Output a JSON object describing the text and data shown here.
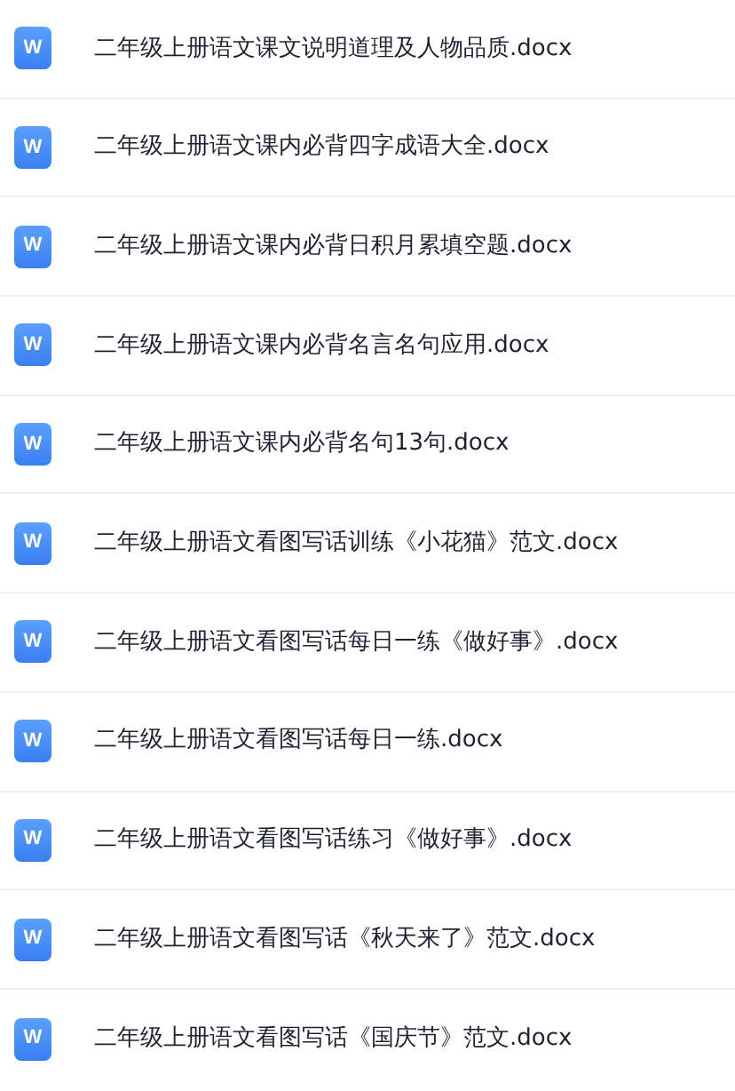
{
  "files": [
    {
      "icon_letter": "W",
      "name": "二年级上册语文课文说明道理及人物品质.docx"
    },
    {
      "icon_letter": "W",
      "name": "二年级上册语文课内必背四字成语大全.docx"
    },
    {
      "icon_letter": "W",
      "name": "二年级上册语文课内必背日积月累填空题.docx"
    },
    {
      "icon_letter": "W",
      "name": "二年级上册语文课内必背名言名句应用.docx"
    },
    {
      "icon_letter": "W",
      "name": "二年级上册语文课内必背名句13句.docx"
    },
    {
      "icon_letter": "W",
      "name": "二年级上册语文看图写话训练《小花猫》范文.docx"
    },
    {
      "icon_letter": "W",
      "name": "二年级上册语文看图写话每日一练《做好事》.docx"
    },
    {
      "icon_letter": "W",
      "name": "二年级上册语文看图写话每日一练.docx"
    },
    {
      "icon_letter": "W",
      "name": "二年级上册语文看图写话练习《做好事》.docx"
    },
    {
      "icon_letter": "W",
      "name": "二年级上册语文看图写话《秋天来了》范文.docx"
    },
    {
      "icon_letter": "W",
      "name": "二年级上册语文看图写话《国庆节》范文.docx"
    }
  ]
}
